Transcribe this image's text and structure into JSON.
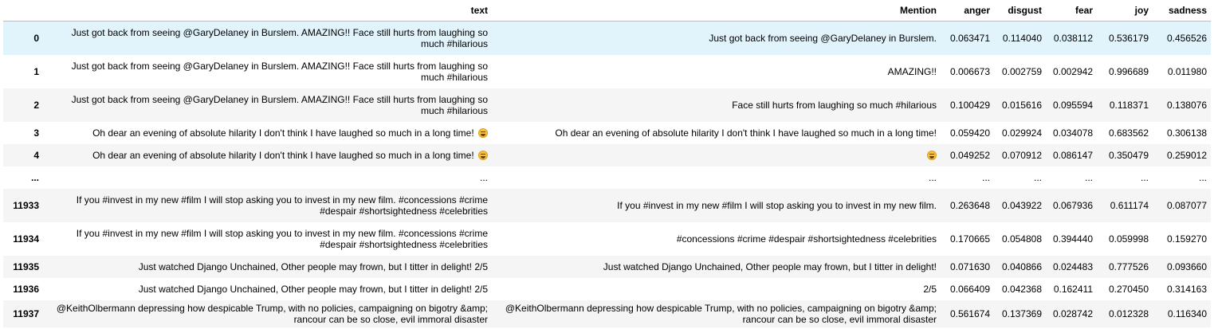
{
  "columns": {
    "index": "",
    "text": "text",
    "mention": "Mention",
    "anger": "anger",
    "disgust": "disgust",
    "fear": "fear",
    "joy": "joy",
    "sadness": "sadness"
  },
  "rows": [
    {
      "index": "0",
      "text": "Just got back from seeing @GaryDelaney in Burslem. AMAZING!! Face still hurts from laughing so much #hilarious",
      "mention": "Just got back from seeing @GaryDelaney in Burslem.",
      "anger": "0.063471",
      "disgust": "0.114040",
      "fear": "0.038112",
      "joy": "0.536179",
      "sadness": "0.456526"
    },
    {
      "index": "1",
      "text": "Just got back from seeing @GaryDelaney in Burslem. AMAZING!! Face still hurts from laughing so much #hilarious",
      "mention": "AMAZING!!",
      "anger": "0.006673",
      "disgust": "0.002759",
      "fear": "0.002942",
      "joy": "0.996689",
      "sadness": "0.011980"
    },
    {
      "index": "2",
      "text": "Just got back from seeing @GaryDelaney in Burslem. AMAZING!! Face still hurts from laughing so much #hilarious",
      "mention": "Face still hurts from laughing so much #hilarious",
      "anger": "0.100429",
      "disgust": "0.015616",
      "fear": "0.095594",
      "joy": "0.118371",
      "sadness": "0.138076"
    },
    {
      "index": "3",
      "text": "Oh dear an evening of absolute hilarity I don't think I have laughed so much in a long time!",
      "mention": "Oh dear an evening of absolute hilarity I don't think I have laughed so much in a long time!",
      "anger": "0.059420",
      "disgust": "0.029924",
      "fear": "0.034078",
      "joy": "0.683562",
      "sadness": "0.306138"
    },
    {
      "index": "4",
      "text": "Oh dear an evening of absolute hilarity I don't think I have laughed so much in a long time!",
      "mention": "",
      "anger": "0.049252",
      "disgust": "0.070912",
      "fear": "0.086147",
      "joy": "0.350479",
      "sadness": "0.259012"
    },
    {
      "index": "...",
      "text": "...",
      "mention": "...",
      "anger": "...",
      "disgust": "...",
      "fear": "...",
      "joy": "...",
      "sadness": "..."
    },
    {
      "index": "11933",
      "text": "If you #invest in my new #film I will stop asking you to invest in my new film. #concessions #crime #despair #shortsightedness #celebrities",
      "mention": "If you #invest in my new #film I will stop asking you to invest in my new film.",
      "anger": "0.263648",
      "disgust": "0.043922",
      "fear": "0.067936",
      "joy": "0.611174",
      "sadness": "0.087077"
    },
    {
      "index": "11934",
      "text": "If you #invest in my new #film I will stop asking you to invest in my new film. #concessions #crime #despair #shortsightedness #celebrities",
      "mention": "#concessions #crime #despair #shortsightedness #celebrities",
      "anger": "0.170665",
      "disgust": "0.054808",
      "fear": "0.394440",
      "joy": "0.059998",
      "sadness": "0.159270"
    },
    {
      "index": "11935",
      "text": "Just watched Django Unchained, Other people may frown, but I titter in delight! 2/5",
      "mention": "Just watched Django Unchained, Other people may frown, but I titter in delight!",
      "anger": "0.071630",
      "disgust": "0.040866",
      "fear": "0.024483",
      "joy": "0.777526",
      "sadness": "0.093660"
    },
    {
      "index": "11936",
      "text": "Just watched Django Unchained, Other people may frown, but I titter in delight! 2/5",
      "mention": "2/5",
      "anger": "0.066409",
      "disgust": "0.042368",
      "fear": "0.162411",
      "joy": "0.270450",
      "sadness": "0.314163"
    },
    {
      "index": "11937",
      "text": "@KeithOlbermann depressing how despicable Trump, with no policies, campaigning on bigotry &amp; rancour can be so close, evil immoral disaster",
      "mention": "@KeithOlbermann depressing how despicable Trump, with no policies, campaigning on bigotry &amp; rancour can be so close, evil immoral disaster",
      "anger": "0.561674",
      "disgust": "0.137369",
      "fear": "0.028742",
      "joy": "0.012328",
      "sadness": "0.116340"
    }
  ],
  "icons": {
    "laughing_emoji": "face-with-tears-of-joy-icon"
  }
}
